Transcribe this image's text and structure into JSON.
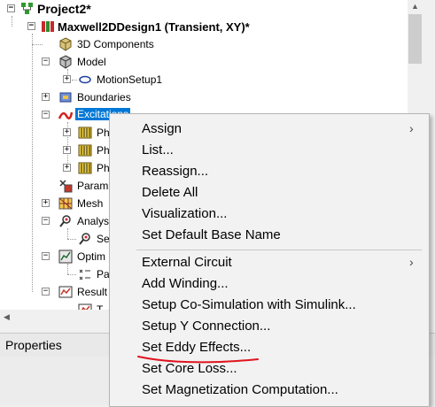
{
  "tree": {
    "project": "Project2*",
    "design": "Maxwell2DDesign1 (Transient, XY)*",
    "items": {
      "components": "3D Components",
      "model": "Model",
      "motion": "MotionSetup1",
      "boundaries": "Boundaries",
      "excitations": "Excitations",
      "phase1": "Ph",
      "phase2": "Ph",
      "phase3": "Ph",
      "parameters": "Param",
      "mesh": "Mesh",
      "analysis": "Analys",
      "setup": "Se",
      "optimetrics": "Optim",
      "param_item": "Pa",
      "results": "Result",
      "result_item": "T"
    }
  },
  "properties_panel": {
    "title": "Properties"
  },
  "context_menu": {
    "items": [
      "Assign",
      "List...",
      "Reassign...",
      "Delete All",
      "Visualization...",
      "Set Default Base Name",
      "External Circuit",
      "Add Winding...",
      "Setup Co-Simulation with Simulink...",
      "Setup Y Connection...",
      "Set Eddy Effects...",
      "Set Core Loss...",
      "Set Magnetization Computation..."
    ],
    "submenu_arrow": "›"
  },
  "colors": {
    "selection": "#0078d7",
    "annotation": "#e0141e"
  }
}
